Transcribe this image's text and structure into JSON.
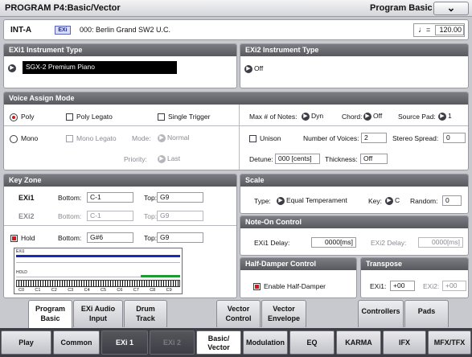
{
  "title": "PROGRAM P4:Basic/Vector",
  "page_menu": "Program Basic",
  "menu_button": "⌄",
  "program": {
    "bank": "INT-A",
    "badge": "EXi",
    "name": "000: Berlin Grand SW2 U.C.",
    "tempo_icon": "♩",
    "tempo_sep": "=",
    "tempo": "120.00"
  },
  "exi1": {
    "title": "EXi1 Instrument Type",
    "value": "SGX-2 Premium Piano"
  },
  "exi2": {
    "title": "EXi2 Instrument Type",
    "value": "Off"
  },
  "voice": {
    "title": "Voice Assign Mode",
    "poly": "Poly",
    "poly_legato": "Poly Legato",
    "single_trigger": "Single Trigger",
    "mono": "Mono",
    "mono_legato": "Mono Legato",
    "mode_label": "Mode:",
    "mode_value": "Normal",
    "priority_label": "Priority:",
    "priority_value": "Last",
    "max_notes_label": "Max # of Notes:",
    "max_notes_value": "Dyn",
    "chord_label": "Chord:",
    "chord_value": "Off",
    "source_pad_label": "Source Pad:",
    "source_pad_value": "1",
    "unison": "Unison",
    "num_voices_label": "Number of Voices:",
    "num_voices": "2",
    "stereo_spread_label": "Stereo Spread:",
    "stereo_spread": "0",
    "detune_label": "Detune:",
    "detune": "000 [cents]",
    "thickness_label": "Thickness:",
    "thickness": "Off"
  },
  "keyzone": {
    "title": "Key Zone",
    "exi1": "EXi1",
    "exi2": "EXi2",
    "bottom_label": "Bottom:",
    "top_label": "Top:",
    "exi1_bottom": "C-1",
    "exi1_top": "G9",
    "exi2_bottom": "C-1",
    "exi2_top": "G9",
    "hold": "Hold",
    "hold_bottom": "G#6",
    "hold_top": "G9",
    "kbd_exi1": "EXi1",
    "kbd_hold": "HOLD",
    "octaves": [
      "C0",
      "C1",
      "C2",
      "C3",
      "C4",
      "C5",
      "C6",
      "C7",
      "C8",
      "C9"
    ]
  },
  "scale": {
    "title": "Scale",
    "type_label": "Type:",
    "type_value": "Equal Temperament",
    "key_label": "Key:",
    "key_value": "C",
    "random_label": "Random:",
    "random_value": "0"
  },
  "noteon": {
    "title": "Note-On Control",
    "exi1_label": "EXi1 Delay:",
    "exi1_value": "0000[ms]",
    "exi2_label": "EXi2 Delay:",
    "exi2_value": "0000[ms]"
  },
  "halfdamper": {
    "title": "Half-Damper Control",
    "enable": "Enable Half-Damper"
  },
  "transpose": {
    "title": "Transpose",
    "exi1_label": "EXi1:",
    "exi1_value": "+00",
    "exi2_label": "EXi2:",
    "exi2_value": "+00"
  },
  "tabs_top": [
    {
      "l1": "Program",
      "l2": "Basic"
    },
    {
      "l1": "EXi Audio",
      "l2": "Input"
    },
    {
      "l1": "Drum",
      "l2": "Track"
    },
    {
      "l1": "Vector",
      "l2": "Control"
    },
    {
      "l1": "Vector",
      "l2": "Envelope"
    },
    {
      "l1": "Controllers",
      "l2": ""
    },
    {
      "l1": "Pads",
      "l2": ""
    }
  ],
  "tabs_bottom": [
    {
      "label": "Play"
    },
    {
      "label": "Common"
    },
    {
      "label": "EXi 1"
    },
    {
      "label": "EXi 2"
    },
    {
      "l1": "Basic/",
      "l2": "Vector"
    },
    {
      "label": "Modulation"
    },
    {
      "label": "EQ"
    },
    {
      "label": "KARMA"
    },
    {
      "label": "IFX"
    },
    {
      "label": "MFX/TFX"
    }
  ],
  "colors": {
    "header": "#5e5f66",
    "accent_red": "#cc1a1a",
    "exi1_bar": "#1a2ab8",
    "hold_bar": "#1e9a2e"
  }
}
